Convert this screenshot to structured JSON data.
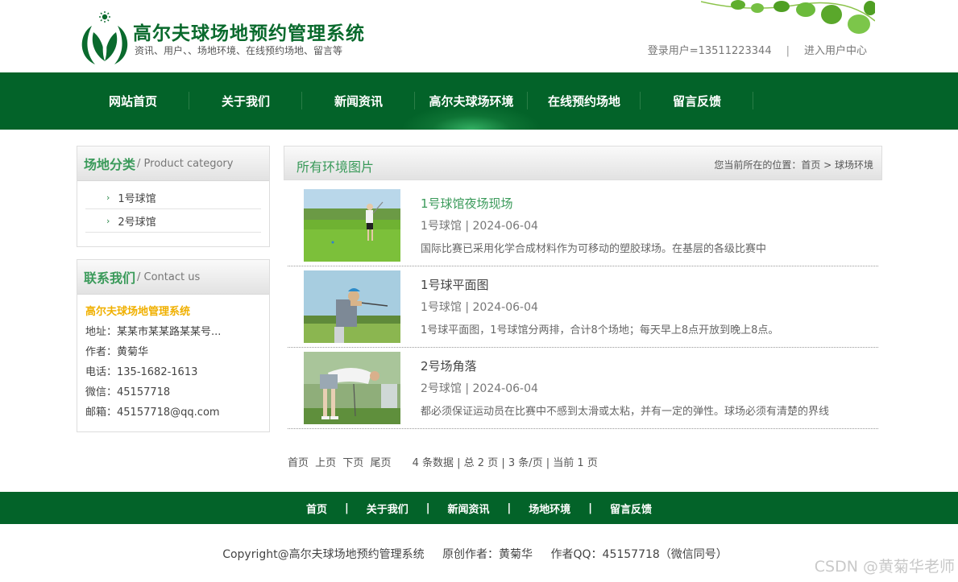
{
  "header": {
    "title": "高尔夫球场地预约管理系统",
    "subtitle": "资讯、用户、、场地环境、在线预约场地、留言等",
    "user_label": "登录用户=13511223344",
    "separator": "|",
    "user_center": "进入用户中心"
  },
  "nav": {
    "items": [
      "网站首页",
      "关于我们",
      "新闻资讯",
      "高尔夫球场环境",
      "在线预约场地",
      "留言反馈"
    ]
  },
  "sidebar": {
    "category": {
      "title_cn": "场地分类",
      "title_en": "/ Product category",
      "items": [
        "1号球馆",
        "2号球馆"
      ]
    },
    "contact": {
      "title_cn": "联系我们",
      "title_en": "/ Contact us",
      "name": "高尔夫球场地管理系统",
      "rows": [
        "地址：某某市某某路某某号...",
        "作者：黄菊华",
        "电话：135-1682-1613",
        "微信：45157718",
        "邮箱：45157718@qq.com"
      ]
    }
  },
  "main": {
    "title": "所有环境图片",
    "breadcrumb": "您当前所在的位置：首页 > 球场环境",
    "items": [
      {
        "title": "1号球馆夜场现场",
        "meta": "1号球馆 | 2024-06-04",
        "desc": "国际比赛已采用化学合成材料作为可移动的塑胶球场。在基层的各级比赛中"
      },
      {
        "title": "1号球平面图",
        "meta": "1号球馆 | 2024-06-04",
        "desc": "1号球平面图，1号球馆分两排，合计8个场地；每天早上8点开放到晚上8点。"
      },
      {
        "title": "2号场角落",
        "meta": "2号球馆 | 2024-06-04",
        "desc": "都必须保证运动员在比赛中不感到太滑或太粘，并有一定的弹性。球场必须有清楚的界线"
      }
    ]
  },
  "pager": {
    "first": "首页",
    "prev": "上页",
    "next": "下页",
    "last": "尾页",
    "info": "4 条数据 | 总 2 页 | 3 条/页 | 当前 1 页"
  },
  "footer": {
    "links": [
      "首页",
      "关于我们",
      "新闻资讯",
      "场地环境",
      "留言反馈"
    ],
    "separator": "|",
    "copyright": "Copyright@高尔夫球场地预约管理系统",
    "author": "原创作者：黄菊华",
    "qq": "作者QQ：45157718（微信同号）"
  },
  "watermark": "CSDN @黄菊华老师",
  "colors": {
    "brand_green": "#036329",
    "accent_green": "#3a9a5a",
    "contact_title": "#f0b000"
  }
}
